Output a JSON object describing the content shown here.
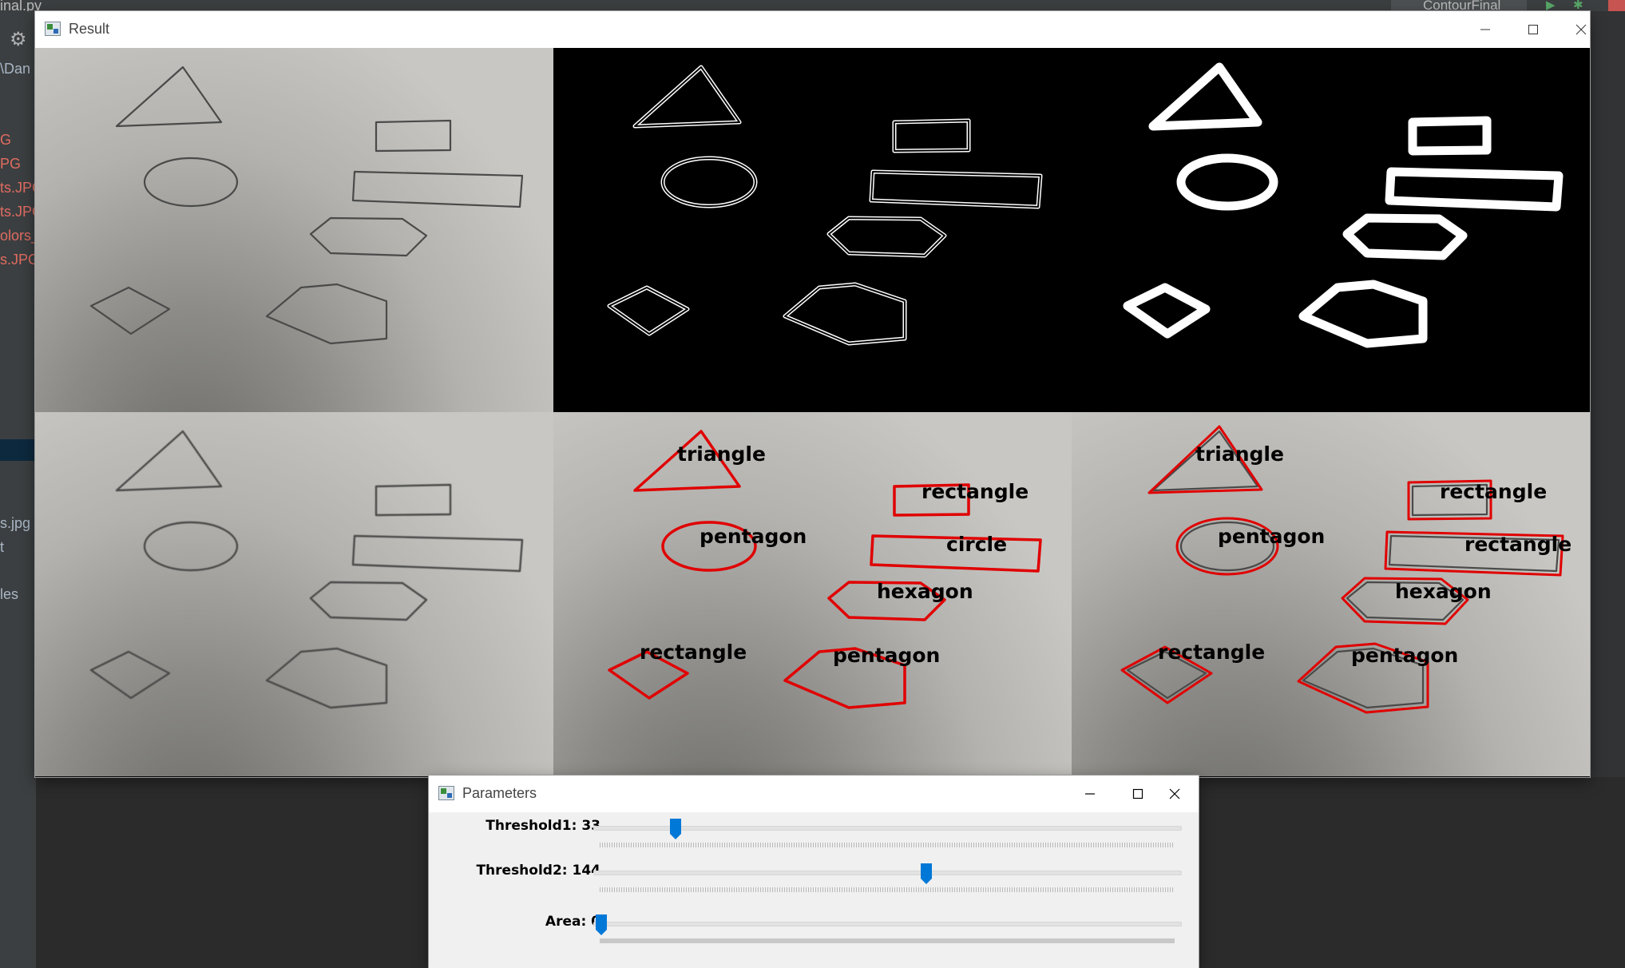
{
  "ide": {
    "file_tab": "inal.py",
    "run_config": "ContourFinal",
    "path_fragment": "\\Dan",
    "project_items": [
      "G",
      "PG",
      "ts.JPG",
      "ts.JPG",
      "olors_",
      "s.JPG"
    ],
    "more_items": [
      "s.jpg",
      "t",
      "les"
    ]
  },
  "result_window": {
    "title": "Result",
    "labels_mid": {
      "triangle": "triangle",
      "rectangle_top": "rectangle",
      "pentagon_oval": "pentagon",
      "circle": "circle",
      "hexagon": "hexagon",
      "rectangle_diamond": "rectangle",
      "pentagon": "pentagon"
    },
    "labels_right": {
      "triangle": "triangle",
      "rectangle_top": "rectangle",
      "pentagon_oval": "pentagon",
      "rectangle_long": "rectangle",
      "hexagon": "hexagon",
      "rectangle_diamond": "rectangle",
      "pentagon": "pentagon"
    },
    "contour_color": "#e00000"
  },
  "parameters_window": {
    "title": "Parameters",
    "sliders": [
      {
        "label": "Threshold1: 33",
        "value": 33,
        "max": 255
      },
      {
        "label": "Threshold2: 144",
        "value": 144,
        "max": 255
      },
      {
        "label": "Area: 0",
        "value": 0,
        "max": 30000
      }
    ],
    "accent": "#0078d7"
  }
}
